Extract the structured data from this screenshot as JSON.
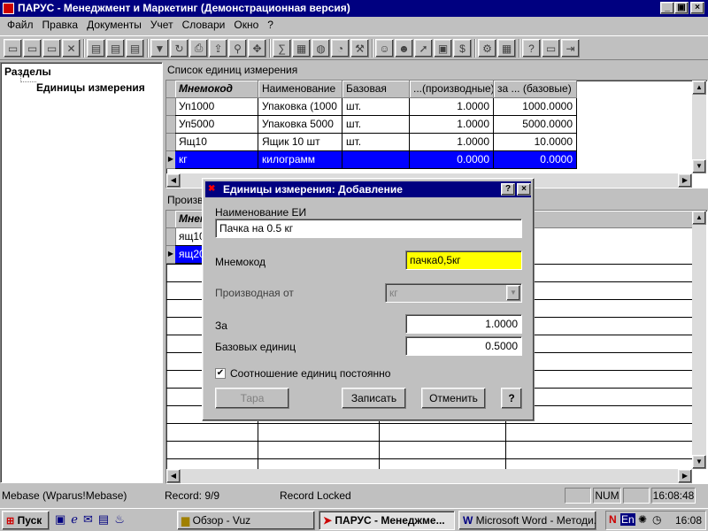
{
  "window": {
    "title": "ПАРУС - Менеджмент и Маркетинг (Демонстрационная версия)",
    "controls": {
      "minimize": "_",
      "maximize": "▣",
      "close": "×"
    }
  },
  "menu": [
    "Файл",
    "Правка",
    "Документы",
    "Учет",
    "Словари",
    "Окно",
    "?"
  ],
  "toolbar": {
    "icons": [
      "new-doc-icon",
      "copy-doc-icon",
      "edit-doc-icon",
      "delete-icon",
      "insert-row-icon",
      "insert-row2-icon",
      "insert-row3-icon",
      "filter-icon",
      "refresh-icon",
      "print-icon",
      "export-icon",
      "link-icon",
      "move-icon",
      "calc-icon",
      "chart-icon",
      "globe-icon",
      "clock-icon",
      "tools-icon",
      "user-icon",
      "users-icon",
      "arrow-icon",
      "card-icon",
      "money-icon",
      "settings-icon",
      "calculator-icon",
      "help-icon",
      "window-icon",
      "exit-icon"
    ]
  },
  "left": {
    "root": "Разделы",
    "item": "Единицы измерения"
  },
  "top_grid": {
    "caption": "Список единиц измерения",
    "columns": [
      "Мнемокод",
      "Наименование",
      "Базовая",
      "...(производные)",
      "за ... (базовые)"
    ],
    "rows": [
      {
        "code": "Уп1000",
        "name": "Упаковка (1000",
        "base": "шт.",
        "derived": "1.0000",
        "basic": "1000.0000"
      },
      {
        "code": "Уп5000",
        "name": "Упаковка 5000",
        "base": "шт.",
        "derived": "1.0000",
        "basic": "5000.0000"
      },
      {
        "code": "Ящ10",
        "name": "Ящик 10 шт",
        "base": "шт.",
        "derived": "1.0000",
        "basic": "10.0000"
      },
      {
        "code": "кг",
        "name": "килограмм",
        "base": "",
        "derived": "0.0000",
        "basic": "0.0000"
      }
    ]
  },
  "bottom_grid": {
    "caption": "Произв",
    "header": "Мнем",
    "rows": [
      "ящ10",
      "ящ20"
    ]
  },
  "dialog": {
    "title": "Единицы измерения: Добавление",
    "help_glyph": "?",
    "close_glyph": "×",
    "name_label": "Наименование ЕИ",
    "name_value": "Пачка на 0.5 кг",
    "code_label": "Мнемокод",
    "code_value": "пачка0,5кг",
    "derived_label": "Производная от",
    "derived_value": "кг",
    "per_label": "За",
    "per_value": "1.0000",
    "base_units_label": "Базовых единиц",
    "base_units_value": "0.5000",
    "constant_label": "Соотношение единиц постоянно",
    "constant_checked": "✔",
    "btn_tara": "Тара",
    "btn_save": "Записать",
    "btn_cancel": "Отменить",
    "btn_help": "?",
    "accent": "#ffff00"
  },
  "status": {
    "db": "Mebase (Wparus!Mebase)",
    "record": "Record: 9/9",
    "lock": "Record Locked",
    "num": "NUM",
    "time": "16:08:48"
  },
  "taskbar": {
    "start": "Пуск",
    "tasks": [
      "Обзор - Vuz",
      "ПАРУС - Менеджме...",
      "Microsoft Word - Методи..."
    ],
    "tray_lang": "En",
    "tray_time": "16:08"
  }
}
